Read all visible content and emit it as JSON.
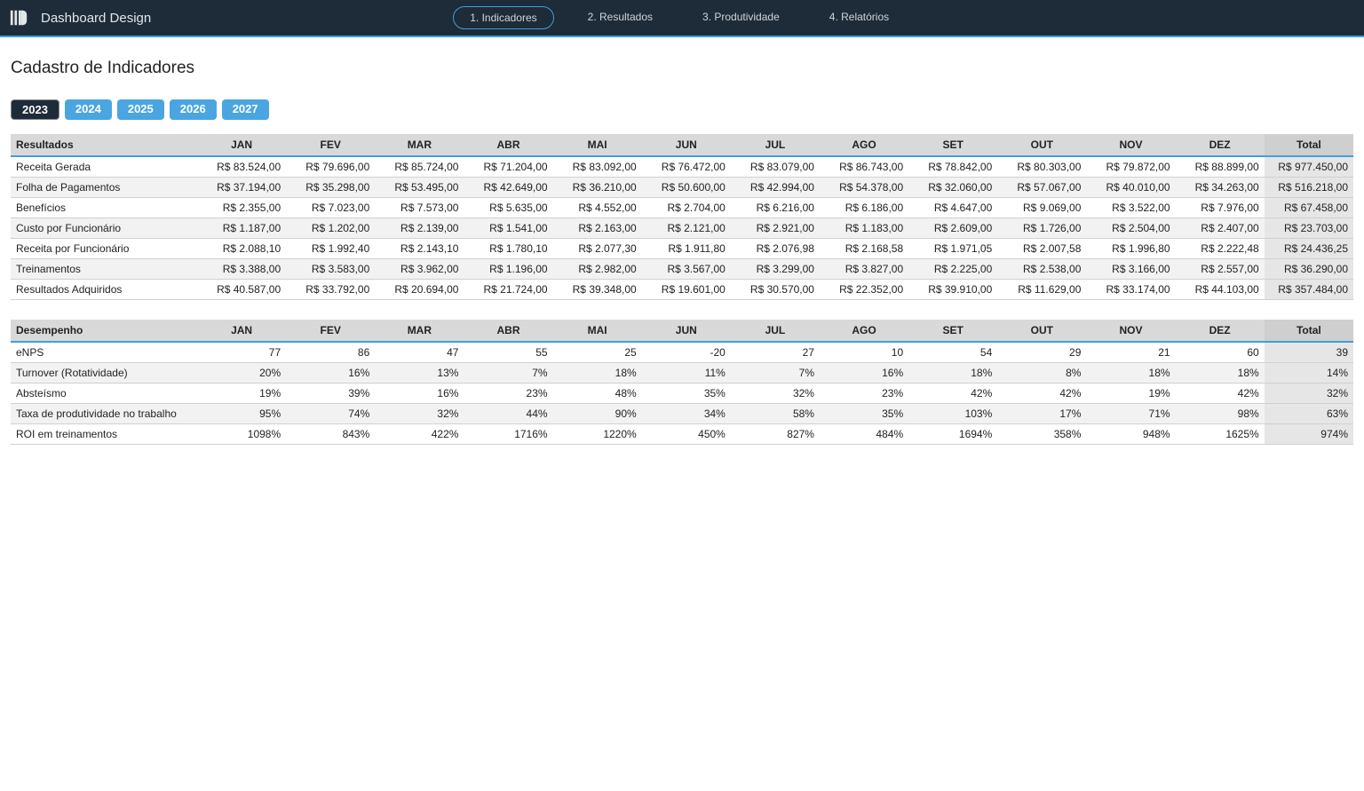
{
  "header": {
    "app_title": "Dashboard Design",
    "nav": [
      {
        "label": "1. Indicadores",
        "active": true
      },
      {
        "label": "2. Resultados",
        "active": false
      },
      {
        "label": "3. Produtividade",
        "active": false
      },
      {
        "label": "4. Relatórios",
        "active": false
      }
    ]
  },
  "page_title": "Cadastro de Indicadores",
  "year_tabs": [
    {
      "label": "2023",
      "active": true
    },
    {
      "label": "2024",
      "active": false
    },
    {
      "label": "2025",
      "active": false
    },
    {
      "label": "2026",
      "active": false
    },
    {
      "label": "2027",
      "active": false
    }
  ],
  "months": [
    "JAN",
    "FEV",
    "MAR",
    "ABR",
    "MAI",
    "JUN",
    "JUL",
    "AGO",
    "SET",
    "OUT",
    "NOV",
    "DEZ"
  ],
  "total_label": "Total",
  "tables": [
    {
      "heading": "Resultados",
      "rows": [
        {
          "label": "Receita Gerada",
          "cells": [
            "R$ 83.524,00",
            "R$ 79.696,00",
            "R$ 85.724,00",
            "R$ 71.204,00",
            "R$ 83.092,00",
            "R$ 76.472,00",
            "R$ 83.079,00",
            "R$ 86.743,00",
            "R$ 78.842,00",
            "R$ 80.303,00",
            "R$ 79.872,00",
            "R$ 88.899,00"
          ],
          "total": "R$ 977.450,00"
        },
        {
          "label": "Folha de Pagamentos",
          "cells": [
            "R$ 37.194,00",
            "R$ 35.298,00",
            "R$ 53.495,00",
            "R$ 42.649,00",
            "R$ 36.210,00",
            "R$ 50.600,00",
            "R$ 42.994,00",
            "R$ 54.378,00",
            "R$ 32.060,00",
            "R$ 57.067,00",
            "R$ 40.010,00",
            "R$ 34.263,00"
          ],
          "total": "R$ 516.218,00"
        },
        {
          "label": "Benefícios",
          "cells": [
            "R$ 2.355,00",
            "R$ 7.023,00",
            "R$ 7.573,00",
            "R$ 5.635,00",
            "R$ 4.552,00",
            "R$ 2.704,00",
            "R$ 6.216,00",
            "R$ 6.186,00",
            "R$ 4.647,00",
            "R$ 9.069,00",
            "R$ 3.522,00",
            "R$ 7.976,00"
          ],
          "total": "R$ 67.458,00"
        },
        {
          "label": "Custo por Funcionário",
          "cells": [
            "R$ 1.187,00",
            "R$ 1.202,00",
            "R$ 2.139,00",
            "R$ 1.541,00",
            "R$ 2.163,00",
            "R$ 2.121,00",
            "R$ 2.921,00",
            "R$ 1.183,00",
            "R$ 2.609,00",
            "R$ 1.726,00",
            "R$ 2.504,00",
            "R$ 2.407,00"
          ],
          "total": "R$ 23.703,00"
        },
        {
          "label": "Receita por Funcionário",
          "cells": [
            "R$ 2.088,10",
            "R$ 1.992,40",
            "R$ 2.143,10",
            "R$ 1.780,10",
            "R$ 2.077,30",
            "R$ 1.911,80",
            "R$ 2.076,98",
            "R$ 2.168,58",
            "R$ 1.971,05",
            "R$ 2.007,58",
            "R$ 1.996,80",
            "R$ 2.222,48"
          ],
          "total": "R$ 24.436,25"
        },
        {
          "label": "Treinamentos",
          "cells": [
            "R$ 3.388,00",
            "R$ 3.583,00",
            "R$ 3.962,00",
            "R$ 1.196,00",
            "R$ 2.982,00",
            "R$ 3.567,00",
            "R$ 3.299,00",
            "R$ 3.827,00",
            "R$ 2.225,00",
            "R$ 2.538,00",
            "R$ 3.166,00",
            "R$ 2.557,00"
          ],
          "total": "R$ 36.290,00"
        },
        {
          "label": "Resultados Adquiridos",
          "cells": [
            "R$ 40.587,00",
            "R$ 33.792,00",
            "R$ 20.694,00",
            "R$ 21.724,00",
            "R$ 39.348,00",
            "R$ 19.601,00",
            "R$ 30.570,00",
            "R$ 22.352,00",
            "R$ 39.910,00",
            "R$ 11.629,00",
            "R$ 33.174,00",
            "R$ 44.103,00"
          ],
          "total": "R$ 357.484,00"
        }
      ]
    },
    {
      "heading": "Desempenho",
      "rows": [
        {
          "label": "eNPS",
          "cells": [
            "77",
            "86",
            "47",
            "55",
            "25",
            "-20",
            "27",
            "10",
            "54",
            "29",
            "21",
            "60"
          ],
          "total": "39"
        },
        {
          "label": "Turnover (Rotatividade)",
          "cells": [
            "20%",
            "16%",
            "13%",
            "7%",
            "18%",
            "11%",
            "7%",
            "16%",
            "18%",
            "8%",
            "18%",
            "18%"
          ],
          "total": "14%"
        },
        {
          "label": "Absteísmo",
          "cells": [
            "19%",
            "39%",
            "16%",
            "23%",
            "48%",
            "35%",
            "32%",
            "23%",
            "42%",
            "42%",
            "19%",
            "42%"
          ],
          "total": "32%"
        },
        {
          "label": "Taxa de produtividade no trabalho",
          "cells": [
            "95%",
            "74%",
            "32%",
            "44%",
            "90%",
            "34%",
            "58%",
            "35%",
            "103%",
            "17%",
            "71%",
            "98%"
          ],
          "total": "63%"
        },
        {
          "label": "ROI em treinamentos",
          "cells": [
            "1098%",
            "843%",
            "422%",
            "1716%",
            "1220%",
            "450%",
            "827%",
            "484%",
            "1694%",
            "358%",
            "948%",
            "1625%"
          ],
          "total": "974%"
        }
      ]
    }
  ]
}
